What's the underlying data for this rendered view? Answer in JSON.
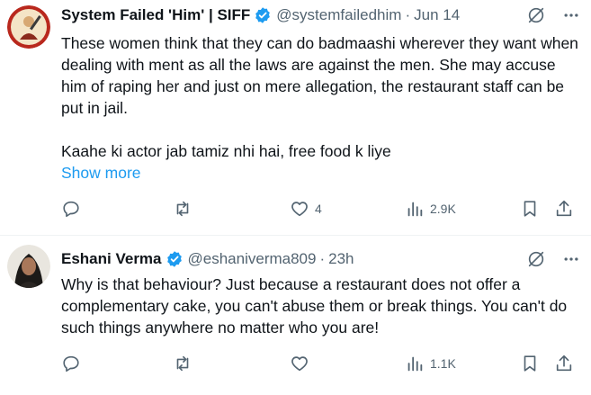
{
  "tweets": [
    {
      "display_name": "System Failed 'Him' | SIFF",
      "handle": "@systemfailedhim",
      "separator": "·",
      "time": "Jun 14",
      "body_lines": [
        "These women think that they can do badmaashi wherever they want when dealing with ment as all the laws are against the men. She may accuse him of raping her and just on mere allegation, the restaurant staff can be put in jail.",
        "Kaahe ki actor jab tamiz nhi hai, free food k liye"
      ],
      "show_more": "Show more",
      "stats": {
        "reply": "",
        "repost": "",
        "like": "4",
        "views": "2.9K"
      }
    },
    {
      "display_name": "Eshani Verma",
      "handle": "@eshaniverma809",
      "separator": "·",
      "time": "23h",
      "body_lines": [
        "Why is that behaviour? Just because a restaurant does not offer a complementary cake, you can't abuse them or break things. You can't do such things anywhere no matter who you are!"
      ],
      "stats": {
        "reply": "",
        "repost": "",
        "like": "",
        "views": "1.1K"
      }
    }
  ],
  "colors": {
    "verified": "#1d9bf0",
    "link": "#1d9bf0",
    "secondary_text": "#536471",
    "primary_text": "#0f1419",
    "divider": "#eff3f4"
  },
  "icons": [
    "verified-badge-icon",
    "grok-icon",
    "more-icon",
    "reply-icon",
    "repost-icon",
    "like-icon",
    "views-icon",
    "bookmark-icon",
    "share-icon"
  ]
}
